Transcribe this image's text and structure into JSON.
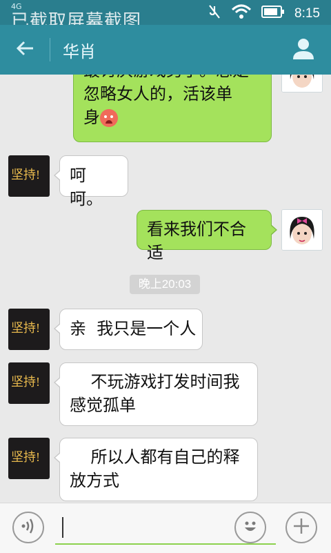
{
  "status_bar": {
    "network": "4G",
    "time": "8:15",
    "toast": "已截取屏幕截图"
  },
  "title_bar": {
    "contact_name": "华肖"
  },
  "avatar_left_text": "坚持!",
  "messages": [
    {
      "side": "out",
      "text_lines": [
        "最讨厌游戏男了。总是",
        "忽略女人的，活该单",
        "身"
      ]
    },
    {
      "side": "in",
      "text": "呵呵。"
    },
    {
      "side": "out",
      "text": "看来我们不合适"
    },
    {
      "side": "in",
      "text": "亲  我只是一个人"
    },
    {
      "side": "in",
      "text_lines": [
        "    不玩游戏打发时间我",
        "感觉孤单"
      ]
    },
    {
      "side": "in",
      "text_lines": [
        "    所以人都有自己的释",
        "放方式"
      ]
    }
  ],
  "timestamp": "晚上20:03",
  "colors": {
    "titlebar": "#2e8d9f",
    "statusbar": "#2a7e8e",
    "bubble_out": "#a4e25c",
    "bubble_in": "#ffffff"
  }
}
